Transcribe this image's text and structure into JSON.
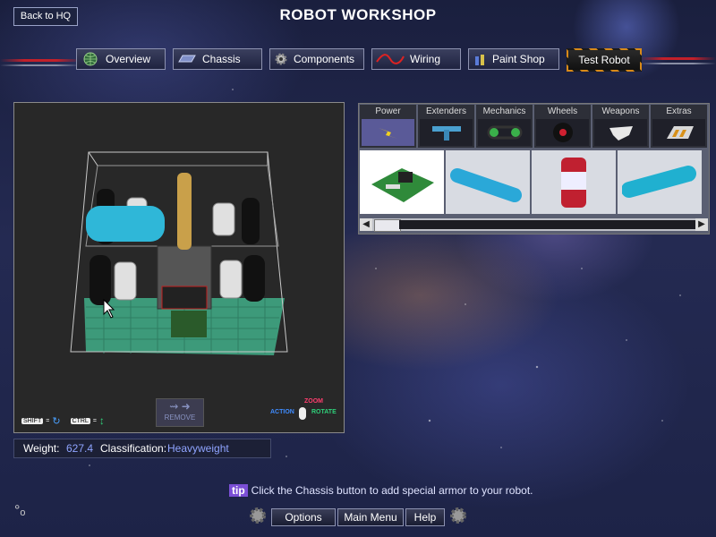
{
  "header": {
    "back_label": "Back to HQ",
    "title": "ROBOT WORKSHOP"
  },
  "tabs": [
    {
      "label": "Overview",
      "icon": "globe-icon"
    },
    {
      "label": "Chassis",
      "icon": "chassis-icon"
    },
    {
      "label": "Components",
      "icon": "gear-icon"
    },
    {
      "label": "Wiring",
      "icon": "wire-icon"
    },
    {
      "label": "Paint Shop",
      "icon": "paint-icon"
    },
    {
      "label": "Test Robot",
      "icon": ""
    }
  ],
  "viewport": {
    "remove_label": "REMOVE",
    "shift_label": "SHIFT",
    "ctrl_label": "CTRL",
    "eq": "=",
    "action_label": "ACTION",
    "zoom_label": "ZOOM",
    "rotate_label": "ROTATE",
    "colors": {
      "floor": "#3d9a7a",
      "motor": "#2fb7d8",
      "rod": "#c9a04a"
    }
  },
  "stats": {
    "weight_label": "Weight:",
    "weight_value": "627.4",
    "class_label": "Classification:",
    "class_value": "Heavyweight"
  },
  "parts": {
    "categories": [
      "Power",
      "Extenders",
      "Mechanics",
      "Wheels",
      "Weapons",
      "Extras"
    ],
    "selected_category": "Power",
    "items": [
      "circuit-board-icon",
      "blue-tank-icon",
      "red-canister-icon",
      "co2-tank-icon"
    ]
  },
  "footer": {
    "tip_badge": "tip",
    "tip_text": "Click the Chassis button to add special armor to your robot.",
    "options_label": "Options",
    "main_menu_label": "Main Menu",
    "help_label": "Help"
  }
}
